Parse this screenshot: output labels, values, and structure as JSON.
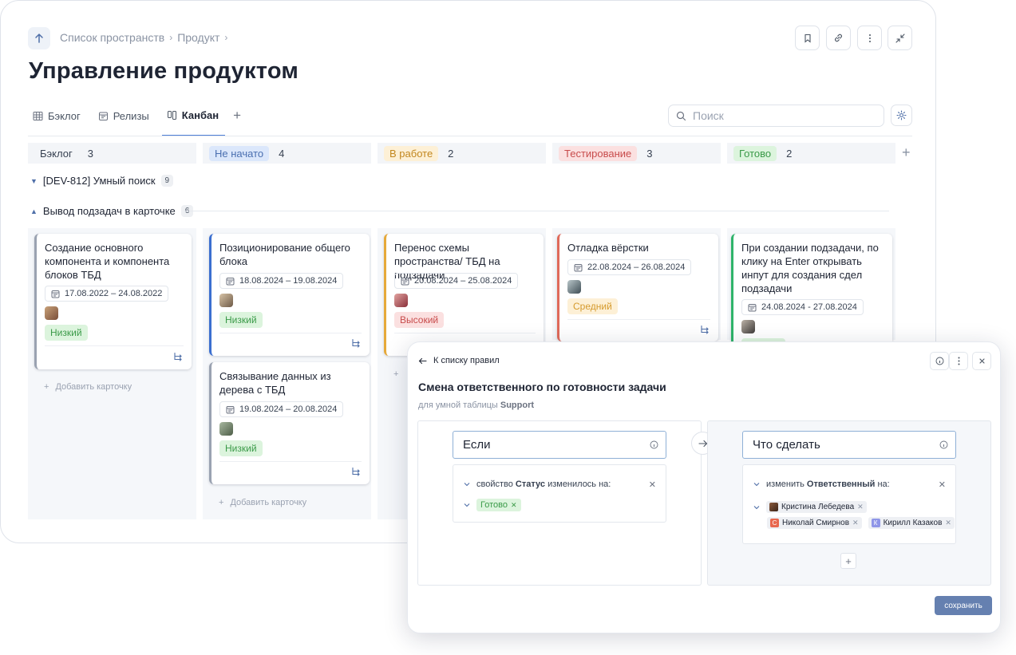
{
  "breadcrumb": {
    "items": [
      "Список пространств",
      "Продукт"
    ]
  },
  "page": {
    "title": "Управление продуктом"
  },
  "tabs": [
    {
      "label": "Бэклог",
      "icon": "table-icon"
    },
    {
      "label": "Релизы",
      "icon": "calendar-icon"
    },
    {
      "label": "Канбан",
      "icon": "kanban-icon",
      "active": true
    }
  ],
  "search": {
    "placeholder": "Поиск"
  },
  "columns": [
    {
      "label": "Бэклог",
      "count": "3",
      "bg": "transparent",
      "color": "#374151"
    },
    {
      "label": "Не начато",
      "count": "4",
      "bg": "#dbe7fb",
      "color": "#4a6fb0"
    },
    {
      "label": "В работе",
      "count": "2",
      "bg": "#fdf0d6",
      "color": "#c2871f"
    },
    {
      "label": "Тестирование",
      "count": "3",
      "bg": "#fbe0e0",
      "color": "#c84c4c"
    },
    {
      "label": "Готово",
      "count": "2",
      "bg": "#dcf4dd",
      "color": "#3a9a48"
    }
  ],
  "groups": [
    {
      "label": "[DEV-812] Умный поиск",
      "count": "9",
      "collapsed": true
    },
    {
      "label": "Вывод подзадач в карточке",
      "count": "6",
      "collapsed": false
    }
  ],
  "cards": [
    {
      "title": "Создание основного компонента и компонента блоков ТБД",
      "dates": "17.08.2022 – 24.08.2022",
      "priority": "Низкий",
      "accent": "#9aa2b1"
    },
    {
      "title": "Позиционирование общего блока",
      "dates": "18.08.2024 – 19.08.2024",
      "priority": "Низкий",
      "accent": "#3b6fd0"
    },
    {
      "title": "Связывание данных из дерева с ТБД",
      "dates": "19.08.2024 – 20.08.2024",
      "priority": "Низкий",
      "accent": "#9aa2b1"
    },
    {
      "title": "Перенос схемы пространства/ ТБД на подзадачи",
      "dates": "20.08.2024 – 25.08.2024",
      "priority": "Высокий",
      "accent": "#e6a93a"
    },
    {
      "title": "Отладка вёрстки",
      "dates": "22.08.2024 – 26.08.2024",
      "priority": "Средний",
      "accent": "#e06a5a"
    },
    {
      "title": "При создании подзадачи, по клику на Enter открывать инпут для создания сдел подзадачи",
      "dates": "24.08.2024 - 27.08.2024",
      "priority": "",
      "accent": "#2fb46a"
    }
  ],
  "add_card_label": "Добавить карточку",
  "rule": {
    "back": "К списку правил",
    "title": "Смена ответственного по готовности задачи",
    "subtitle_prefix": "для умной таблицы",
    "subtitle_table": "Support",
    "if_label": "Если",
    "then_label": "Что сделать",
    "condition_prefix": "свойство",
    "condition_property": "Статус",
    "condition_suffix": "изменилось на:",
    "condition_value": "Готово",
    "action_prefix": "изменить",
    "action_property": "Ответственный",
    "action_suffix": "на:",
    "assignees": [
      "Кристина Лебедева",
      "Николай Смирнов",
      "Кирилл Казаков"
    ],
    "save": "сохранить"
  }
}
